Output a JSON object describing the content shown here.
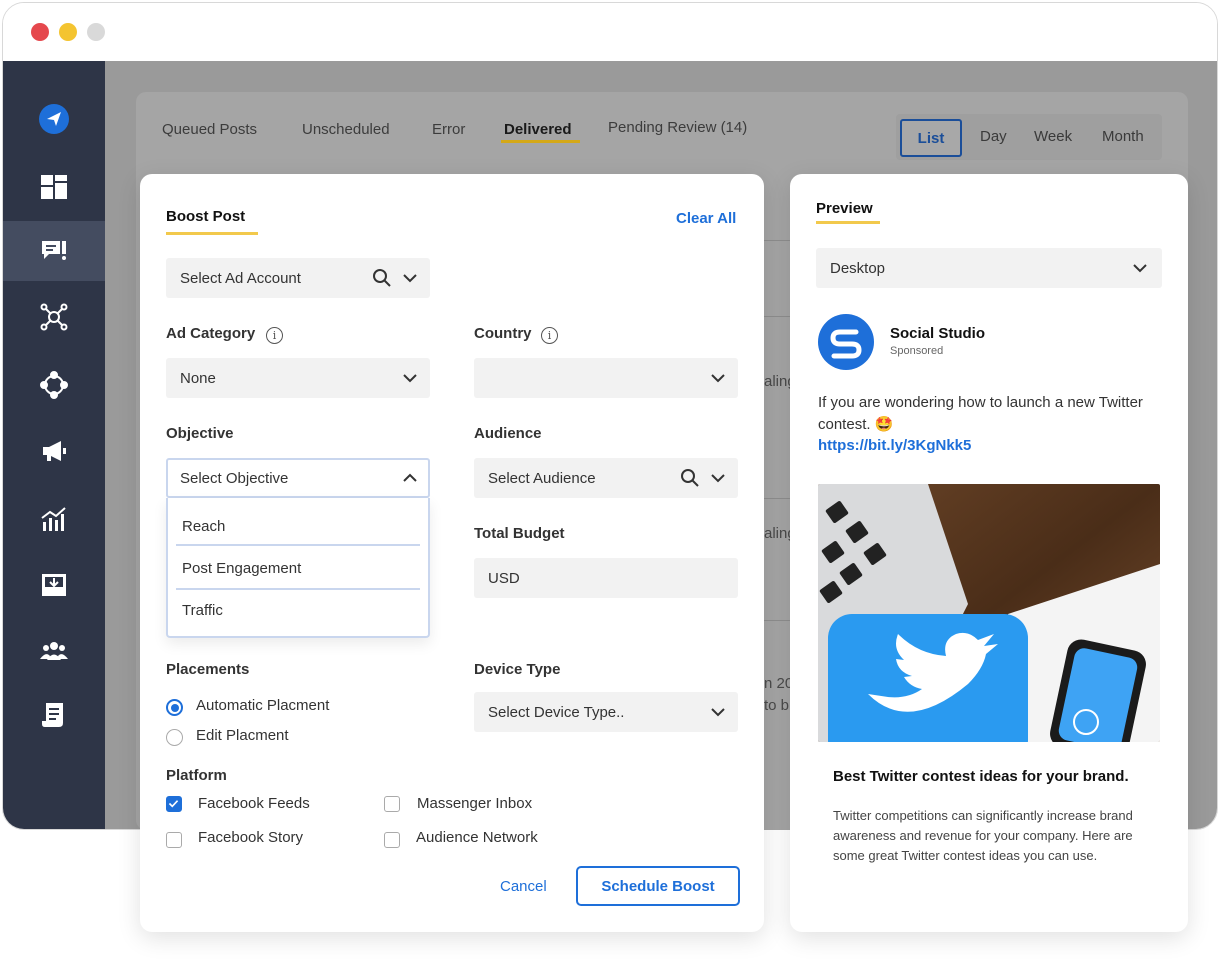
{
  "tabs": [
    "Queued Posts",
    "Unscheduled",
    "Error",
    "Delivered",
    "Pending Review (14)"
  ],
  "views": [
    "List",
    "Day",
    "Week",
    "Month"
  ],
  "background_fragments": [
    "aling",
    "aling",
    "n 20",
    "to b"
  ],
  "sidebar": {
    "icons": [
      "send-icon",
      "dashboard-icon",
      "messages-icon",
      "network-icon",
      "integrations-icon",
      "megaphone-icon",
      "analytics-icon",
      "inbox-download-icon",
      "team-icon",
      "reports-icon"
    ]
  },
  "boost": {
    "title": "Boost Post",
    "clear_all": "Clear All",
    "ad_account_placeholder": "Select Ad Account",
    "ad_category_label": "Ad Category",
    "ad_category_value": "None",
    "country_label": "Country",
    "country_value": "",
    "objective_label": "Objective",
    "objective_placeholder": "Select Objective",
    "objective_options": [
      "Reach",
      "Post Engagement",
      "Traffic"
    ],
    "audience_label": "Audience",
    "audience_placeholder": "Select Audience",
    "total_budget_label": "Total Budget",
    "currency": "USD",
    "placements_label": "Placements",
    "placement_options": [
      {
        "label": "Automatic Placment",
        "selected": true
      },
      {
        "label": "Edit Placment",
        "selected": false
      }
    ],
    "device_type_label": "Device Type",
    "device_type_placeholder": "Select Device Type..",
    "platform_label": "Platform",
    "platforms": [
      {
        "label": "Facebook Feeds",
        "checked": true
      },
      {
        "label": "Massenger Inbox",
        "checked": false
      },
      {
        "label": "Facebook Story",
        "checked": false
      },
      {
        "label": "Audience Network",
        "checked": false
      }
    ],
    "cancel": "Cancel",
    "schedule": "Schedule Boost"
  },
  "preview": {
    "title": "Preview",
    "device": "Desktop",
    "brand": "Social Studio",
    "sponsored": "Sponsored",
    "post_text": "If you are wondering how to launch a new Twitter contest. 🤩",
    "post_link": "https://bit.ly/3KgNkk5",
    "card_title": "Best Twitter contest ideas for your brand.",
    "card_description": "Twitter competitions can significantly increase brand awareness and revenue for your company. Here are some great Twitter contest ideas you can use."
  },
  "colors": {
    "accent": "#1e6fd9",
    "sidebar": "#2e3547",
    "underline": "#f2c94c"
  }
}
